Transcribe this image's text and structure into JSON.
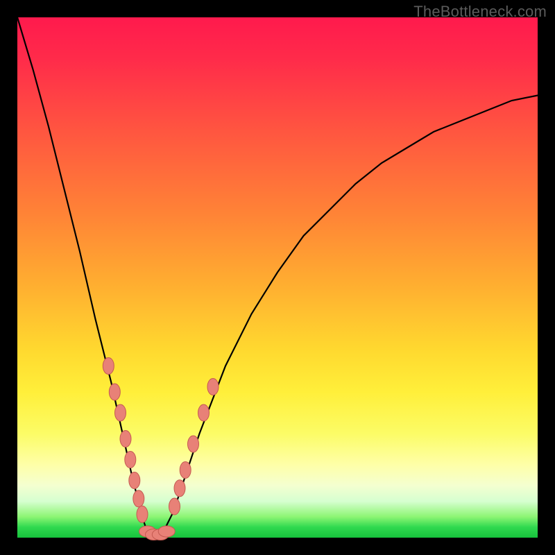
{
  "watermark": "TheBottleneck.com",
  "colors": {
    "frame": "#000000",
    "gradient_top": "#ff1a4d",
    "gradient_mid": "#ffd92f",
    "gradient_bottom": "#17c23c",
    "curve": "#000000",
    "marker_fill": "#e88177",
    "marker_stroke": "#c45a51"
  },
  "chart_data": {
    "type": "line",
    "title": "",
    "xlabel": "",
    "ylabel": "",
    "xlim": [
      0,
      100
    ],
    "ylim": [
      0,
      100
    ],
    "grid": false,
    "legend": false,
    "note": "V-shaped bottleneck curve. y≈100 is worst (red), y≈0 is best (green). Minimum near x≈26 where y≈0.",
    "series": [
      {
        "name": "bottleneck-curve",
        "x": [
          0,
          3,
          6,
          9,
          12,
          15,
          18,
          20,
          22,
          24,
          25,
          26,
          27,
          28,
          30,
          32,
          35,
          40,
          45,
          50,
          55,
          60,
          65,
          70,
          75,
          80,
          85,
          90,
          95,
          100
        ],
        "values": [
          100,
          90,
          79,
          67,
          55,
          42,
          30,
          21,
          12,
          4,
          1,
          0,
          0,
          1,
          5,
          11,
          20,
          33,
          43,
          51,
          58,
          63,
          68,
          72,
          75,
          78,
          80,
          82,
          84,
          85
        ]
      }
    ],
    "markers": [
      {
        "name": "left-cluster",
        "points": [
          {
            "x": 17.5,
            "y": 33
          },
          {
            "x": 18.7,
            "y": 28
          },
          {
            "x": 19.8,
            "y": 24
          },
          {
            "x": 20.8,
            "y": 19
          },
          {
            "x": 21.7,
            "y": 15
          },
          {
            "x": 22.5,
            "y": 11
          },
          {
            "x": 23.3,
            "y": 7.5
          },
          {
            "x": 24.0,
            "y": 4.5
          }
        ]
      },
      {
        "name": "trough-cluster",
        "points": [
          {
            "x": 25.0,
            "y": 1.2
          },
          {
            "x": 26.2,
            "y": 0.6
          },
          {
            "x": 27.5,
            "y": 0.6
          },
          {
            "x": 28.7,
            "y": 1.2
          }
        ]
      },
      {
        "name": "right-cluster",
        "points": [
          {
            "x": 30.2,
            "y": 6
          },
          {
            "x": 31.2,
            "y": 9.5
          },
          {
            "x": 32.3,
            "y": 13
          },
          {
            "x": 33.8,
            "y": 18
          },
          {
            "x": 35.8,
            "y": 24
          },
          {
            "x": 37.6,
            "y": 29
          }
        ]
      }
    ]
  }
}
